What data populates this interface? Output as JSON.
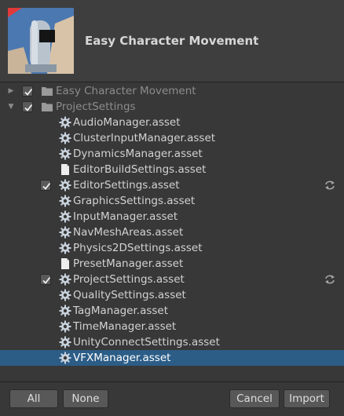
{
  "header": {
    "title": "Easy Character Movement",
    "thumbnail_icon": "character-thumbnail"
  },
  "tree": {
    "items": [
      {
        "label": "Easy Character Movement",
        "checked": true,
        "foldout": "collapsed",
        "icon": "folder-icon",
        "refresh": false
      },
      {
        "label": "ProjectSettings",
        "checked": true,
        "foldout": "expanded",
        "icon": "folder-icon",
        "refresh": false
      },
      {
        "label": "AudioManager.asset",
        "checked": false,
        "icon": "settings-gear-icon",
        "refresh": false
      },
      {
        "label": "ClusterInputManager.asset",
        "checked": false,
        "icon": "settings-gear-icon",
        "refresh": false
      },
      {
        "label": "DynamicsManager.asset",
        "checked": false,
        "icon": "settings-gear-icon",
        "refresh": false
      },
      {
        "label": "EditorBuildSettings.asset",
        "checked": false,
        "icon": "document-icon",
        "refresh": false
      },
      {
        "label": "EditorSettings.asset",
        "checked": true,
        "icon": "settings-gear-icon",
        "refresh": true
      },
      {
        "label": "GraphicsSettings.asset",
        "checked": false,
        "icon": "settings-gear-icon",
        "refresh": false
      },
      {
        "label": "InputManager.asset",
        "checked": false,
        "icon": "settings-gear-icon",
        "refresh": false
      },
      {
        "label": "NavMeshAreas.asset",
        "checked": false,
        "icon": "settings-gear-icon",
        "refresh": false
      },
      {
        "label": "Physics2DSettings.asset",
        "checked": false,
        "icon": "settings-gear-icon",
        "refresh": false
      },
      {
        "label": "PresetManager.asset",
        "checked": false,
        "icon": "document-icon",
        "refresh": false
      },
      {
        "label": "ProjectSettings.asset",
        "checked": true,
        "icon": "settings-gear-icon",
        "refresh": true
      },
      {
        "label": "QualitySettings.asset",
        "checked": false,
        "icon": "settings-gear-icon",
        "refresh": false
      },
      {
        "label": "TagManager.asset",
        "checked": false,
        "icon": "settings-gear-icon",
        "refresh": false
      },
      {
        "label": "TimeManager.asset",
        "checked": false,
        "icon": "settings-gear-icon",
        "refresh": false
      },
      {
        "label": "UnityConnectSettings.asset",
        "checked": false,
        "icon": "settings-gear-icon",
        "refresh": false
      },
      {
        "label": "VFXManager.asset",
        "checked": false,
        "icon": "settings-gear-icon",
        "refresh": false,
        "selected": true
      }
    ]
  },
  "footer": {
    "all_label": "All",
    "none_label": "None",
    "cancel_label": "Cancel",
    "import_label": "Import"
  },
  "colors": {
    "background": "#383838",
    "selection": "#2c5d87",
    "button": "#585858"
  }
}
